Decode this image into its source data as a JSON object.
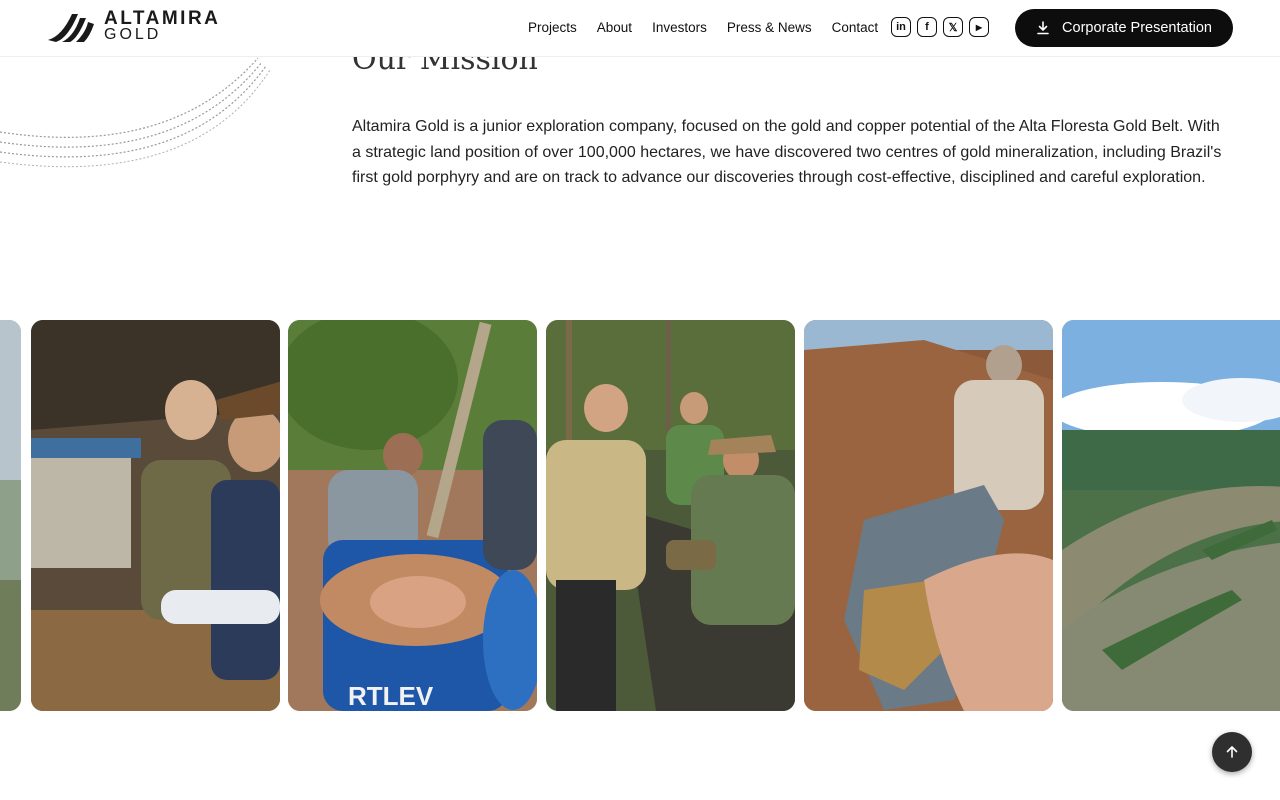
{
  "brand": {
    "name": "ALTAMIRA",
    "sub": "GOLD"
  },
  "nav": {
    "items": [
      {
        "label": "Projects"
      },
      {
        "label": "About"
      },
      {
        "label": "Investors"
      },
      {
        "label": "Press & News"
      },
      {
        "label": "Contact"
      }
    ]
  },
  "socials": [
    {
      "name": "linkedin-icon",
      "glyph": "in"
    },
    {
      "name": "facebook-icon",
      "glyph": "f"
    },
    {
      "name": "x-icon",
      "glyph": "𝕏"
    },
    {
      "name": "youtube-icon",
      "glyph": "▶"
    }
  ],
  "cta": {
    "label": "Corporate Presentation",
    "icon": "download-icon"
  },
  "mission": {
    "title": "Our Mission",
    "text": "Altamira Gold is a junior exploration company, focused on the gold and copper potential of the Alta Floresta Gold Belt. With a strategic land position of over 100,000 hectares, we have discovered two centres of gold mineralization, including Brazil's first gold porphyry and are on track to advance our discoveries through cost-effective, disciplined and careful exploration."
  },
  "gallery": {
    "photos": [
      {
        "name": "photo-river-partial"
      },
      {
        "name": "photo-core-inspection"
      },
      {
        "name": "photo-gold-panning"
      },
      {
        "name": "photo-jungle-rock-sampling"
      },
      {
        "name": "photo-ore-sample-hand"
      },
      {
        "name": "photo-aerial-river"
      }
    ]
  },
  "colors": {
    "primary": "#0d0d0d",
    "background": "#ffffff",
    "scroll_top": "#2f2f2f"
  },
  "scroll_top_icon": "arrow-up-icon"
}
